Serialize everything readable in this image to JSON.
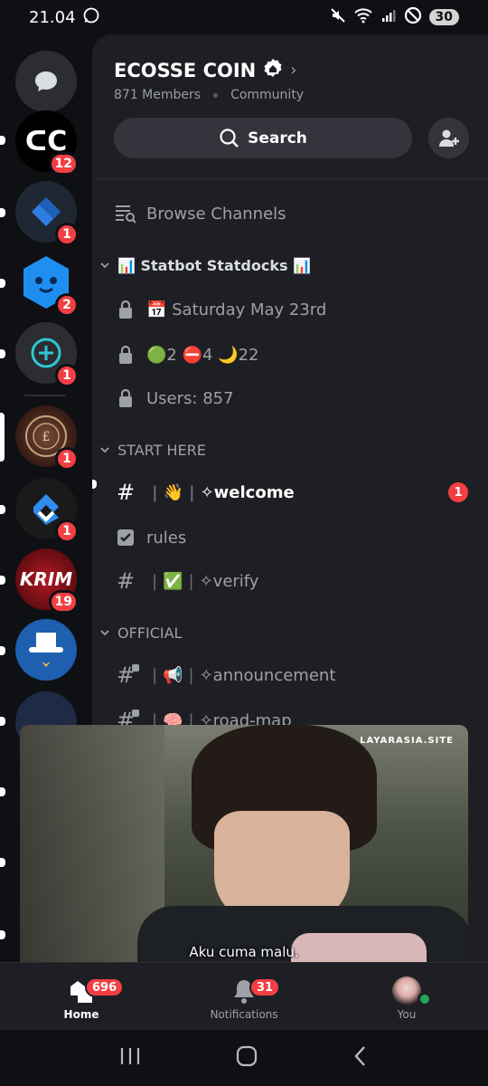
{
  "status_bar": {
    "time": "21.04",
    "battery": "30"
  },
  "servers": [
    {
      "name": "dc-server",
      "badge": "12",
      "color": "#000000"
    },
    {
      "name": "blue-diamond-server",
      "badge": "1",
      "color": "#1f2a44"
    },
    {
      "name": "blue-cube-server",
      "badge": "2",
      "color": "#1e7be0"
    },
    {
      "name": "plus-circle-server",
      "badge": "1",
      "color": "#2b2d31"
    },
    {
      "name": "emblem-server",
      "badge": "1",
      "color": "#4a2a22"
    },
    {
      "name": "c-logo-server",
      "badge": "1",
      "color": "#1a1a1a"
    },
    {
      "name": "krim-server",
      "badge": "19",
      "color": "#8b0d18",
      "label": "KRIM"
    },
    {
      "name": "top-hat-server",
      "badge": "",
      "color": "#1e5fb0"
    }
  ],
  "header": {
    "server_name": "ECOSSE COIN",
    "members": "871 Members",
    "type": "Community",
    "search_label": "Search"
  },
  "channels": {
    "browse": "Browse Channels",
    "cat_statbot": "📊 Statbot Statdocks 📊",
    "date": "📅 Saturday May 23rd",
    "status_count": "🟢2 ⛔4 🌙22",
    "users": "Users: 857",
    "cat_start": "START HERE",
    "welcome_emoji": "👋",
    "welcome": "✧welcome",
    "welcome_badge": "1",
    "rules": "rules",
    "verify_emoji": "✅",
    "verify": "✧verify",
    "cat_official": "OFFICIAL",
    "announce_emoji": "📢",
    "announce": "✧announcement",
    "roadmap_emoji": "🧠",
    "roadmap": "✧road-map"
  },
  "video": {
    "watermark": "LAYARASIA.SITE",
    "subtitle": "Aku cuma malu."
  },
  "bottom_nav": {
    "home": "Home",
    "home_badge": "696",
    "notifications": "Notifications",
    "notifications_badge": "31",
    "you": "You"
  }
}
